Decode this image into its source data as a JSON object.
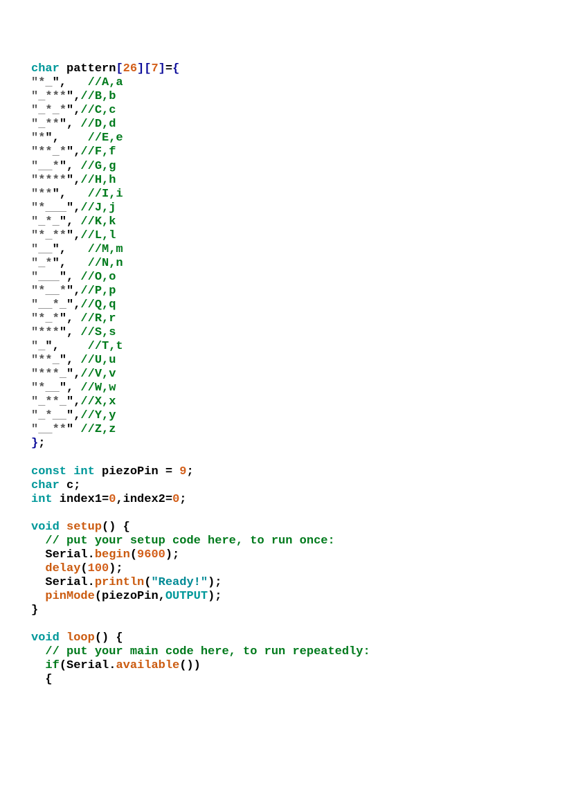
{
  "code": {
    "decl": {
      "kw": "char",
      "name": "pattern",
      "dim1": "26",
      "dim2": "7",
      "equals": "="
    },
    "patterns": [
      {
        "open": "\"",
        "s": "*",
        "u": " ",
        "t": "",
        "close": "\",   ",
        "c": "//A,a"
      },
      {
        "open": "\"",
        "s": "",
        "u": " ",
        "t": "***",
        "close": "\",",
        "c": "//B,b"
      },
      {
        "open": "\"",
        "s": "",
        "u": " ",
        "t": "*",
        "u2": " ",
        "t2": "*",
        "close": "\",",
        "c": "//C,c"
      },
      {
        "open": "\"",
        "s": "",
        "u": " ",
        "t": "**",
        "close": "\", ",
        "c": "//D,d"
      },
      {
        "open": "\"",
        "s": "*",
        "u": "",
        "t": "",
        "close": "\",    ",
        "c": "//E,e"
      },
      {
        "open": "\"",
        "s": "**",
        "u": " ",
        "t": "*",
        "close": "\",",
        "c": "//F,f"
      },
      {
        "open": "\"",
        "s": "",
        "u": "  ",
        "t": "*",
        "close": "\", ",
        "c": "//G,g"
      },
      {
        "open": "\"",
        "s": "****",
        "u": "",
        "t": "",
        "close": "\",",
        "c": "//H,h"
      },
      {
        "open": "\"",
        "s": "**",
        "u": "",
        "t": "",
        "close": "\",   ",
        "c": "//I,i"
      },
      {
        "open": "\"",
        "s": "*",
        "u": "   ",
        "t": "",
        "close": "\",",
        "c": "//J,j"
      },
      {
        "open": "\"",
        "s": "",
        "u": " ",
        "t": "*",
        "u2": " ",
        "t2": "",
        "close": "\", ",
        "c": "//K,k"
      },
      {
        "open": "\"",
        "s": "*",
        "u": " ",
        "t": "**",
        "close": "\",",
        "c": "//L,l"
      },
      {
        "open": "\"",
        "s": "",
        "u": "  ",
        "t": "",
        "close": "\",   ",
        "c": "//M,m"
      },
      {
        "open": "\"",
        "s": "",
        "u": " ",
        "t": "*",
        "close": "\",   ",
        "c": "//N,n"
      },
      {
        "open": "\"",
        "s": "",
        "u": "   ",
        "t": "",
        "close": "\", ",
        "c": "//O,o"
      },
      {
        "open": "\"",
        "s": "*",
        "u": "  ",
        "t": "*",
        "close": "\",",
        "c": "//P,p"
      },
      {
        "open": "\"",
        "s": "",
        "u": "  ",
        "t": "*",
        "u2": " ",
        "t2": "",
        "close": "\",",
        "c": "//Q,q"
      },
      {
        "open": "\"",
        "s": "*",
        "u": " ",
        "t": "*",
        "close": "\", ",
        "c": "//R,r"
      },
      {
        "open": "\"",
        "s": "***",
        "u": "",
        "t": "",
        "close": "\", ",
        "c": "//S,s"
      },
      {
        "open": "\"",
        "s": "",
        "u": " ",
        "t": "",
        "close": "\",    ",
        "c": "//T,t"
      },
      {
        "open": "\"",
        "s": "**",
        "u": " ",
        "t": "",
        "close": "\", ",
        "c": "//U,u"
      },
      {
        "open": "\"",
        "s": "***",
        "u": " ",
        "t": "",
        "close": "\",",
        "c": "//V,v"
      },
      {
        "open": "\"",
        "s": "*",
        "u": "  ",
        "t": "",
        "close": "\", ",
        "c": "//W,w"
      },
      {
        "open": "\"",
        "s": "",
        "u": " ",
        "t": "**",
        "u2": " ",
        "t2": "",
        "close": "\",",
        "c": "//X,x"
      },
      {
        "open": "\"",
        "s": "",
        "u": " ",
        "t": "*",
        "u2": "  ",
        "t2": "",
        "close": "\",",
        "c": "//Y,y"
      },
      {
        "open": "\"",
        "s": "",
        "u": "  ",
        "t": "**",
        "close": "\" ",
        "c": "//Z,z"
      }
    ],
    "closebrace": "};",
    "piezo": {
      "kw1": "const",
      "kw2": "int",
      "name": "piezoPin",
      "eq": " = ",
      "val": "9",
      "semi": ";"
    },
    "charc": {
      "kw": "char",
      "name": "c",
      "semi": ";"
    },
    "index": {
      "kw": "int",
      "n1": "index1",
      "eq1": "=",
      "v1": "0",
      "comma": ",",
      "n2": "index2",
      "eq2": "=",
      "v2": "0",
      "semi": ";"
    },
    "setup": {
      "kw": "void",
      "name": "setup",
      "paren": "()",
      "ob": " {",
      "c1": "// put your setup code here, to run once:",
      "l1a": "Serial",
      "l1b": ".",
      "l1c": "begin",
      "l1d": "(",
      "l1e": "9600",
      "l1f": ");",
      "l2a": "delay",
      "l2b": "(",
      "l2c": "100",
      "l2d": ");",
      "l3a": "Serial",
      "l3b": ".",
      "l3c": "println",
      "l3d": "(",
      "l3e": "\"Ready!\"",
      "l3f": ");",
      "l4a": "pinMode",
      "l4b": "(piezoPin,",
      "l4c": "OUTPUT",
      "l4d": ");",
      "cb": "}"
    },
    "loop": {
      "kw": "void",
      "name": "loop",
      "paren": "()",
      "ob": " {",
      "c1": "// put your main code here, to run repeatedly:",
      "l1a": "if",
      "l1b": "(",
      "l1c": "Serial",
      "l1d": ".",
      "l1e": "available",
      "l1f": "())",
      "ob2": "{"
    }
  }
}
